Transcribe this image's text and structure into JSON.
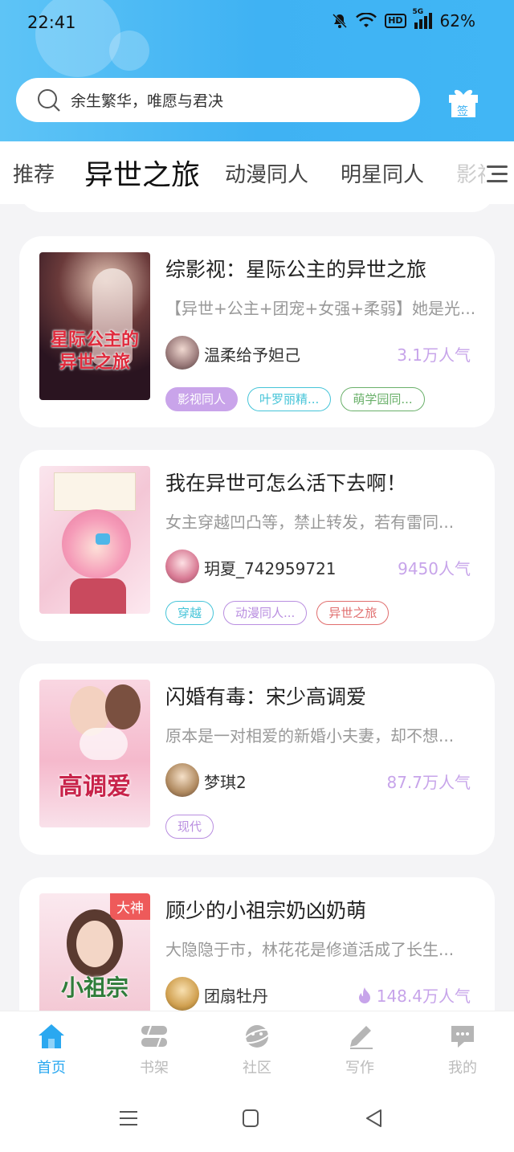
{
  "status": {
    "time": "22:41",
    "hd": "HD",
    "network": "5G",
    "battery": "62%"
  },
  "search": {
    "placeholder": "余生繁华，唯愿与君决"
  },
  "gift": {
    "label": "签"
  },
  "tabs": [
    "推荐",
    "异世之旅",
    "动漫同人",
    "明星同人",
    "影视"
  ],
  "active_tab": 1,
  "books": [
    {
      "title": "综影视：星际公主的异世之旅",
      "desc": "【异世+公主+团宠+女强+柔弱】她是光...",
      "author": "温柔给予妲己",
      "popularity": "3.1万人气",
      "cover_text": "星际公主的异世之旅",
      "tags": [
        {
          "label": "影视同人",
          "color": "#b98ee0",
          "filled": true
        },
        {
          "label": "叶罗丽精...",
          "color": "#45c4d8",
          "filled": false
        },
        {
          "label": "萌学园同...",
          "color": "#6ab06a",
          "filled": false
        }
      ]
    },
    {
      "title": "我在异世可怎么活下去啊！",
      "desc": "女主穿越凹凸等，禁止转发，若有雷同...",
      "author": "玥夏_742959721",
      "popularity": "9450人气",
      "cover_text": "",
      "tags": [
        {
          "label": "穿越",
          "color": "#45c4d8",
          "filled": false
        },
        {
          "label": "动漫同人...",
          "color": "#b98ee0",
          "filled": false
        },
        {
          "label": "异世之旅",
          "color": "#e06d6d",
          "filled": false
        }
      ]
    },
    {
      "title": "闪婚有毒：宋少高调爱",
      "desc": "原本是一对相爱的新婚小夫妻，却不想...",
      "author": "梦琪2",
      "popularity": "87.7万人气",
      "cover_text": "高调爱",
      "tags": [
        {
          "label": "现代",
          "color": "#b98ee0",
          "filled": false
        }
      ]
    },
    {
      "title": "顾少的小祖宗奶凶奶萌",
      "desc": "大隐隐于市，林花花是修道活成了长生...",
      "author": "团扇牡丹",
      "popularity": "148.4万人气",
      "badge": "大神",
      "cover_text": "小祖宗",
      "tags": []
    }
  ],
  "nav": [
    {
      "label": "首页",
      "active": true
    },
    {
      "label": "书架",
      "active": false
    },
    {
      "label": "社区",
      "active": false
    },
    {
      "label": "写作",
      "active": false
    },
    {
      "label": "我的",
      "active": false
    }
  ],
  "colors": {
    "accent": "#2aa8f0",
    "purple": "#b98ee0",
    "header": "#41b6f5"
  }
}
